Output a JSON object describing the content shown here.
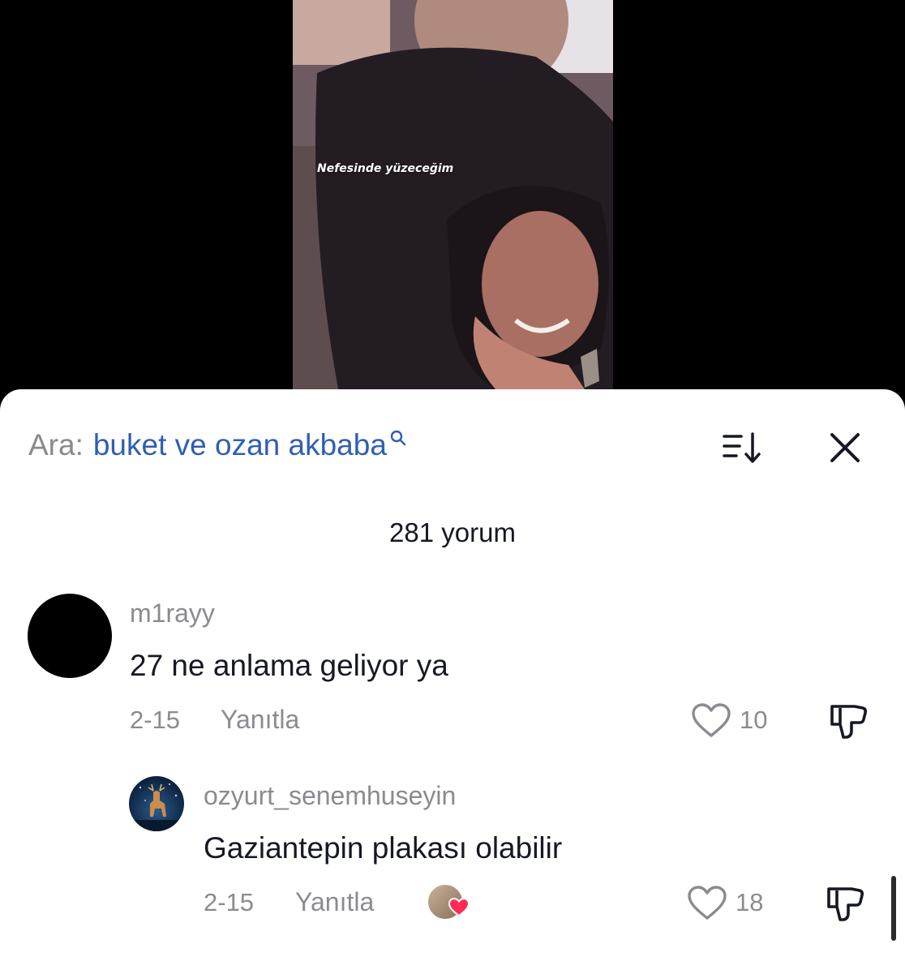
{
  "video": {
    "caption": "Nefesinde yüzeceğim"
  },
  "search": {
    "label": "Ara:",
    "term": "buket ve ozan akbaba"
  },
  "comments_header": {
    "count_text": "281 yorum"
  },
  "comments": [
    {
      "username": "m1rayy",
      "text": "27 ne anlama geliyor ya",
      "date": "2-15",
      "reply_label": "Yanıtla",
      "likes": "10"
    },
    {
      "username": "ozyurt_senemhuseyin",
      "text": "Gaziantepin plakası olabilir",
      "date": "2-15",
      "reply_label": "Yanıtla",
      "likes": "18"
    }
  ],
  "icons": {
    "search": "search-icon",
    "sort": "sort-icon",
    "close": "close-icon",
    "like": "heart-outline-icon",
    "dislike": "thumbs-down-icon",
    "creator_liked": "heart-filled-icon"
  },
  "colors": {
    "search_term": "#2f5fb3",
    "muted": "#8a8b91",
    "text": "#161823",
    "heart": "#fe2c55"
  }
}
